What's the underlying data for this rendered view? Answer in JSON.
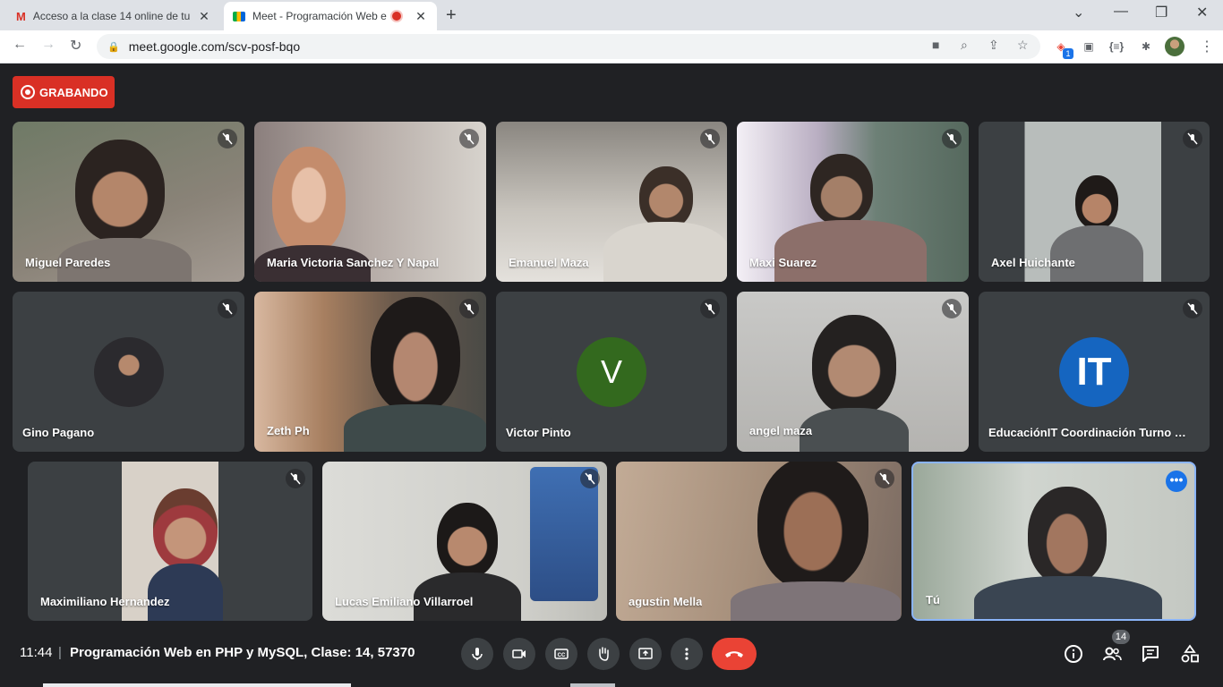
{
  "browser": {
    "tabs": [
      {
        "title": "Acceso a la clase 14 online de tu",
        "icon": "gmail-icon"
      },
      {
        "title": "Meet - Programación Web e",
        "icon": "meet-icon",
        "recording": true
      }
    ],
    "url": "meet.google.com/scv-posf-bqo",
    "extension_badge": "1"
  },
  "meet": {
    "recording_label": "GRABANDO",
    "participants": [
      {
        "name": "Miguel Paredes",
        "muted": true
      },
      {
        "name": "Maria Victoria Sanchez Y Napal",
        "muted": true
      },
      {
        "name": "Emanuel Maza",
        "muted": true
      },
      {
        "name": "Maxi Suarez",
        "muted": true
      },
      {
        "name": "Axel Huichante",
        "muted": true
      },
      {
        "name": "Gino Pagano",
        "muted": true
      },
      {
        "name": "Zeth Ph",
        "muted": true
      },
      {
        "name": "Victor Pinto",
        "muted": true,
        "initial": "V",
        "color": "#33691e"
      },
      {
        "name": "angel maza",
        "muted": true
      },
      {
        "name": "EducaciónIT Coordinación Turno Día ...",
        "muted": true,
        "initial": "IT",
        "color": "#1565c0"
      },
      {
        "name": "Maximiliano Hernandez",
        "muted": true
      },
      {
        "name": "Lucas Emiliano Villarroel",
        "muted": true
      },
      {
        "name": "agustin Mella",
        "muted": true
      },
      {
        "name": "Tú",
        "muted": false
      }
    ],
    "clock": "11:44",
    "separator": "|",
    "meeting_title": "Programación Web en PHP y MySQL, Clase: 14, 57370",
    "participant_count": "14",
    "accent": "#ea4335"
  }
}
